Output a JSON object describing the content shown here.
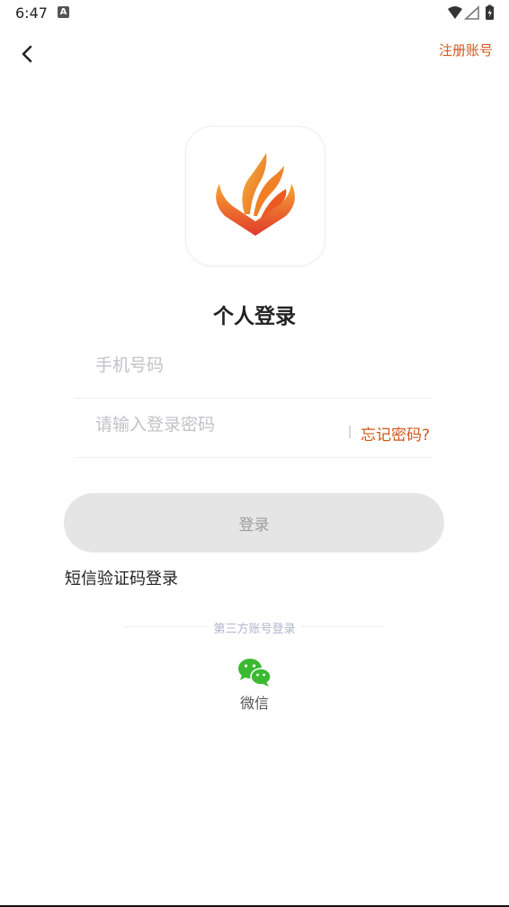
{
  "status_bar": {
    "time": "6:47",
    "notification_letter": "A"
  },
  "header": {
    "register_label": "注册账号"
  },
  "page": {
    "title": "个人登录"
  },
  "form": {
    "phone_placeholder": "手机号码",
    "password_placeholder": "请输入登录密码",
    "forgot_label": "忘记密码?",
    "login_label": "登录",
    "sms_login_label": "短信验证码登录"
  },
  "third_party": {
    "heading": "第三方账号登录",
    "wechat_label": "微信"
  },
  "colors": {
    "accent": "#d0571b",
    "button_bg": "#e5e5e5",
    "wechat_green": "#3bb931"
  },
  "icons": {
    "back": "chevron-left-icon",
    "wechat": "wechat-icon",
    "wifi": "wifi-icon",
    "signal": "signal-icon",
    "battery": "battery-icon"
  }
}
